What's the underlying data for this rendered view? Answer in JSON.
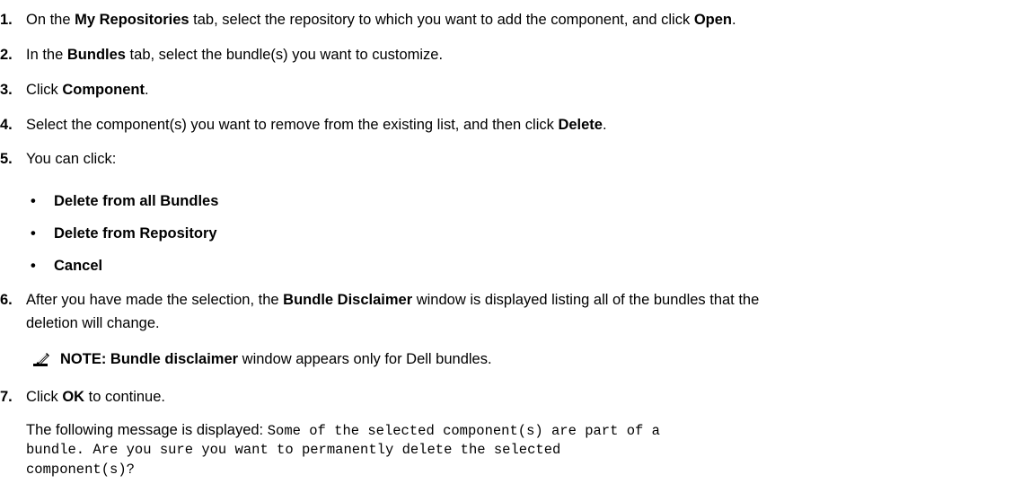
{
  "steps": {
    "s1": {
      "num": "1.",
      "t1": "On the ",
      "b1": "My Repositories",
      "t2": " tab, select the repository to which you want to add the component, and click ",
      "b2": "Open",
      "t3": "."
    },
    "s2": {
      "num": "2.",
      "t1": "In the ",
      "b1": "Bundles",
      "t2": " tab, select the bundle(s) you want to customize."
    },
    "s3": {
      "num": "3.",
      "t1": "Click ",
      "b1": "Component",
      "t2": "."
    },
    "s4": {
      "num": "4.",
      "t1": "Select the component(s) you want to remove from the existing list, and then click ",
      "b1": "Delete",
      "t2": "."
    },
    "s5": {
      "num": "5.",
      "t1": "You can click:"
    },
    "s6": {
      "num": "6.",
      "t1": "After you have made the selection, the ",
      "b1": "Bundle Disclaimer",
      "t2": " window is displayed listing all of the bundles that the",
      "line2": "deletion will change."
    },
    "s7": {
      "num": "7.",
      "t1": "Click ",
      "b1": "OK",
      "t2": " to continue."
    }
  },
  "options": {
    "bullet": "•",
    "items": [
      "Delete from all Bundles",
      "Delete from Repository",
      "Cancel"
    ]
  },
  "note": {
    "icon": "pencil-note-icon",
    "label": "NOTE: ",
    "bold": "Bundle disclaimer",
    "text": " window appears only for Dell bundles."
  },
  "message": {
    "lead": "The following message is displayed: ",
    "line1": "Some of the selected component(s) are part of a",
    "line2": "bundle. Are you sure you want to permanently delete the selected",
    "line3": "component(s)?"
  }
}
